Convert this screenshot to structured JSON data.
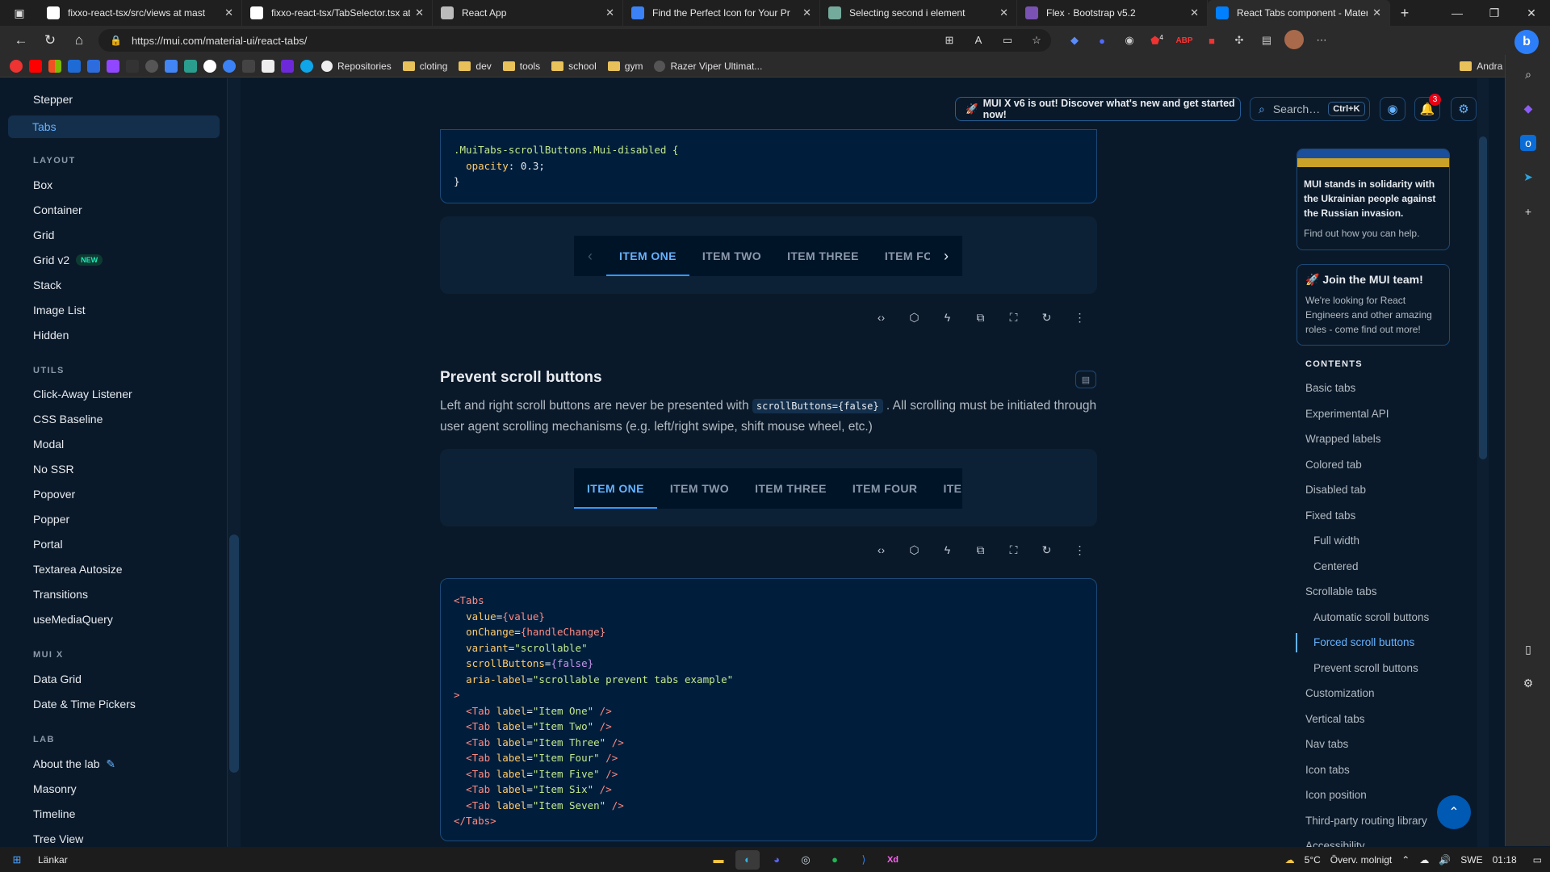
{
  "browser": {
    "tabs": [
      {
        "title": "fixxo-react-tsx/src/views at mast",
        "favicon": "github-icon",
        "color": "#ffffff"
      },
      {
        "title": "fixxo-react-tsx/TabSelector.tsx at",
        "favicon": "github-icon",
        "color": "#ffffff"
      },
      {
        "title": "React App",
        "favicon": "page-icon",
        "color": "#bbbbbb"
      },
      {
        "title": "Find the Perfect Icon for Your Pr",
        "favicon": "flag-icon",
        "color": "#3b82f6"
      },
      {
        "title": "Selecting second i element",
        "favicon": "chatgpt-icon",
        "color": "#74aa9c"
      },
      {
        "title": "Flex · Bootstrap v5.2",
        "favicon": "bootstrap-icon",
        "color": "#7952b3"
      },
      {
        "title": "React Tabs component - Materia",
        "favicon": "mui-icon",
        "color": "#007fff"
      }
    ],
    "new_tab": "+",
    "url": "https://mui.com/material-ui/react-tabs/",
    "bookmarks": [
      {
        "label": "Repositories",
        "icon": "github-icon"
      },
      {
        "label": "cloting",
        "icon": "folder-icon"
      },
      {
        "label": "dev",
        "icon": "folder-icon"
      },
      {
        "label": "tools",
        "icon": "folder-icon"
      },
      {
        "label": "school",
        "icon": "folder-icon"
      },
      {
        "label": "gym",
        "icon": "folder-icon"
      },
      {
        "label": "Razer Viper Ultimat...",
        "icon": "razer-icon"
      }
    ],
    "other_bookmarks": "Andra favoriter",
    "extension_badge": "4"
  },
  "leftnav": {
    "items_top": [
      "Stepper",
      "Tabs"
    ],
    "sections": [
      {
        "title": "LAYOUT",
        "items": [
          "Box",
          "Container",
          "Grid",
          "Grid v2",
          "Stack",
          "Image List",
          "Hidden"
        ]
      },
      {
        "title": "UTILS",
        "items": [
          "Click-Away Listener",
          "CSS Baseline",
          "Modal",
          "No SSR",
          "Popover",
          "Popper",
          "Portal",
          "Textarea Autosize",
          "Transitions",
          "useMediaQuery"
        ]
      },
      {
        "title": "MUI X",
        "items": [
          "Data Grid",
          "Date & Time Pickers"
        ]
      },
      {
        "title": "LAB",
        "items": [
          "About the lab",
          "Masonry",
          "Timeline",
          "Tree View"
        ]
      }
    ],
    "new_badge": "NEW"
  },
  "header": {
    "banner": "MUI X v6 is out! Discover what's new and get started now!",
    "search_label": "Search…",
    "search_shortcut": "Ctrl+K",
    "notification_count": "3"
  },
  "top_code": {
    "selector": ".MuiTabs-scrollButtons.Mui-disabled {",
    "prop": "opacity",
    "value": "0.3;",
    "close": "}"
  },
  "demo1": {
    "tabs": [
      "ITEM ONE",
      "ITEM TWO",
      "ITEM THREE",
      "ITEM FOUR"
    ],
    "selected": 0
  },
  "section": {
    "title": "Prevent scroll buttons",
    "para_before": "Left and right scroll buttons are never be presented with",
    "inline_code": "scrollButtons={false}",
    "para_after": ". All scrolling must be initiated through user agent scrolling mechanisms (e.g. left/right swipe, shift mouse wheel, etc.)"
  },
  "demo2": {
    "tabs": [
      "ITEM ONE",
      "ITEM TWO",
      "ITEM THREE",
      "ITEM FOUR",
      "ITEM F"
    ],
    "selected": 0
  },
  "code": {
    "open": "<Tabs",
    "attrs": [
      {
        "name": "value",
        "value": "{value}",
        "kind": "expr"
      },
      {
        "name": "onChange",
        "value": "{handleChange}",
        "kind": "expr"
      },
      {
        "name": "variant",
        "value": "\"scrollable\"",
        "kind": "str"
      },
      {
        "name": "scrollButtons",
        "value": "{false}",
        "kind": "bool"
      },
      {
        "name": "aria-label",
        "value": "\"scrollable prevent tabs example\"",
        "kind": "str"
      }
    ],
    "gt": ">",
    "tabs": [
      "\"Item One\"",
      "\"Item Two\"",
      "\"Item Three\"",
      "\"Item Four\"",
      "\"Item Five\"",
      "\"Item Six\"",
      "\"Item Seven\""
    ],
    "close": "</Tabs>"
  },
  "right": {
    "ukraine_title": "MUI stands in solidarity with the Ukrainian people against the Russian invasion.",
    "ukraine_link": "Find out how you can help.",
    "join_title": "Join the MUI team!",
    "join_text": "We're looking for React Engineers and other amazing roles - come find out more!",
    "contents_title": "CONTENTS",
    "toc": [
      {
        "label": "Basic tabs",
        "indent": 0
      },
      {
        "label": "Experimental API",
        "indent": 0
      },
      {
        "label": "Wrapped labels",
        "indent": 0
      },
      {
        "label": "Colored tab",
        "indent": 0
      },
      {
        "label": "Disabled tab",
        "indent": 0
      },
      {
        "label": "Fixed tabs",
        "indent": 0
      },
      {
        "label": "Full width",
        "indent": 1
      },
      {
        "label": "Centered",
        "indent": 1
      },
      {
        "label": "Scrollable tabs",
        "indent": 0
      },
      {
        "label": "Automatic scroll buttons",
        "indent": 1
      },
      {
        "label": "Forced scroll buttons",
        "indent": 1,
        "active": true
      },
      {
        "label": "Prevent scroll buttons",
        "indent": 1
      },
      {
        "label": "Customization",
        "indent": 0
      },
      {
        "label": "Vertical tabs",
        "indent": 0
      },
      {
        "label": "Nav tabs",
        "indent": 0
      },
      {
        "label": "Icon tabs",
        "indent": 0
      },
      {
        "label": "Icon position",
        "indent": 0
      },
      {
        "label": "Third-party routing library",
        "indent": 0
      },
      {
        "label": "Accessibility",
        "indent": 0
      }
    ]
  },
  "taskbar": {
    "links_label": "Länkar",
    "temperature": "5°C",
    "weather": "Överv. molnigt",
    "language": "SWE",
    "time": "01:18"
  },
  "colors": {
    "accent": "#66b2ff",
    "background": "#0a1929",
    "code_bg": "#001e3c"
  }
}
